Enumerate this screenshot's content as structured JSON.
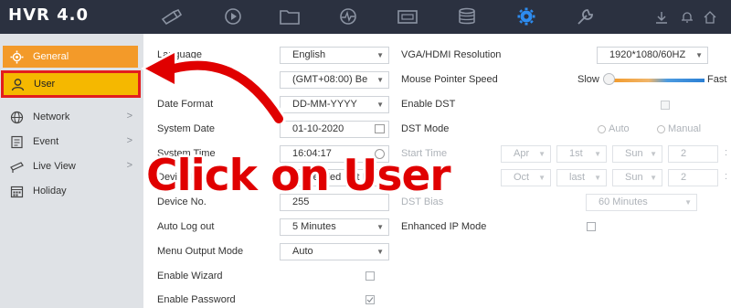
{
  "app": {
    "brand": "HVR 4.0"
  },
  "topnav": {
    "items": [
      {
        "name": "camera",
        "icon": "camera-icon"
      },
      {
        "name": "playback",
        "icon": "playback-icon"
      },
      {
        "name": "files",
        "icon": "folder-icon"
      },
      {
        "name": "status",
        "icon": "status-icon"
      },
      {
        "name": "record",
        "icon": "record-icon"
      },
      {
        "name": "storage",
        "icon": "storage-icon"
      },
      {
        "name": "configuration",
        "icon": "gear-icon",
        "active": true
      },
      {
        "name": "maintenance",
        "icon": "wrench-icon"
      }
    ],
    "utilities": [
      "download-icon",
      "bell-icon",
      "home-icon"
    ]
  },
  "sidebar": {
    "items": [
      {
        "label": "General",
        "icon": "gear-icon",
        "state": "active"
      },
      {
        "label": "User",
        "icon": "user-icon",
        "state": "highlighted"
      },
      {
        "label": "Network",
        "icon": "globe-icon",
        "chevron": ">"
      },
      {
        "label": "Event",
        "icon": "event-icon",
        "chevron": ">"
      },
      {
        "label": "Live View",
        "icon": "eye-icon",
        "chevron": ">"
      },
      {
        "label": "Holiday",
        "icon": "calendar-icon"
      }
    ]
  },
  "left_form": {
    "language_label": "Language",
    "language_value": "English",
    "timezone_value": "(GMT+08:00) Be",
    "date_format_label": "Date Format",
    "date_format_value": "DD-MM-YYYY",
    "system_date_label": "System Date",
    "system_date_value": "01-10-2020",
    "system_time_label": "System Time",
    "system_time_value": "16:04:17",
    "device_name_label": "Device Na",
    "device_name_value": "Embedded Net D",
    "device_no_label": "Device No.",
    "device_no_value": "255",
    "auto_logout_label": "Auto Log out",
    "auto_logout_value": "5 Minutes",
    "menu_output_label": "Menu Output Mode",
    "menu_output_value": "Auto",
    "enable_wizard_label": "Enable Wizard",
    "enable_wizard_checked": false,
    "enable_password_label": "Enable Password",
    "enable_password_checked": true
  },
  "right_form": {
    "resolution_label": "VGA/HDMI Resolution",
    "resolution_value": "1920*1080/60HZ",
    "pointer_speed_label": "Mouse Pointer Speed",
    "slow_label": "Slow",
    "fast_label": "Fast",
    "enable_dst_label": "Enable DST",
    "dst_mode_label": "DST Mode",
    "dst_mode_auto": "Auto",
    "dst_mode_manual": "Manual",
    "start_time_label": "Start Time",
    "start_month": "Apr",
    "start_week": "1st",
    "start_day": "Sun",
    "start_hour": "2",
    "start_extra": ":",
    "end_month": "Oct",
    "end_week": "last",
    "end_day": "Sun",
    "end_hour": "2",
    "end_extra": ":",
    "dst_bias_label": "DST Bias",
    "dst_bias_value": "60 Minutes",
    "enhanced_ip_label": "Enhanced IP Mode",
    "enhanced_ip_checked": false
  },
  "annotation": {
    "text": "Click on User",
    "color": "#e00000"
  }
}
